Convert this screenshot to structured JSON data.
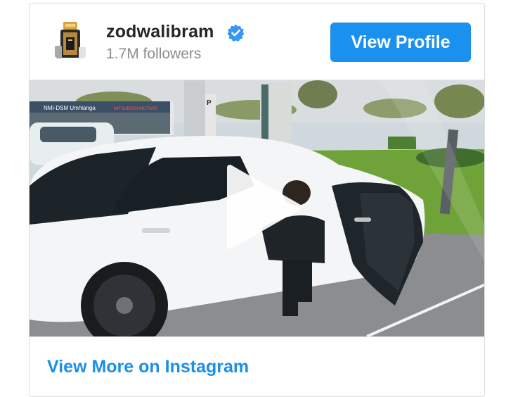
{
  "profile": {
    "username": "zodwalibram",
    "followers": "1.7M followers",
    "view_profile_label": "View Profile",
    "avatar_icon": "perfume-bottle-icon",
    "verified_icon": "verified-badge-icon"
  },
  "media": {
    "type": "video",
    "play_icon": "play-icon",
    "scene_signs": {
      "dealer": "NMI-DSM Umhlanga",
      "brand": "MITSUBISHI MOTORS",
      "parking": "P"
    }
  },
  "footer": {
    "view_more_label": "View More on Instagram"
  },
  "colors": {
    "button": "#1a91ee",
    "link": "#1a8fe8",
    "verified": "#3897f0"
  }
}
